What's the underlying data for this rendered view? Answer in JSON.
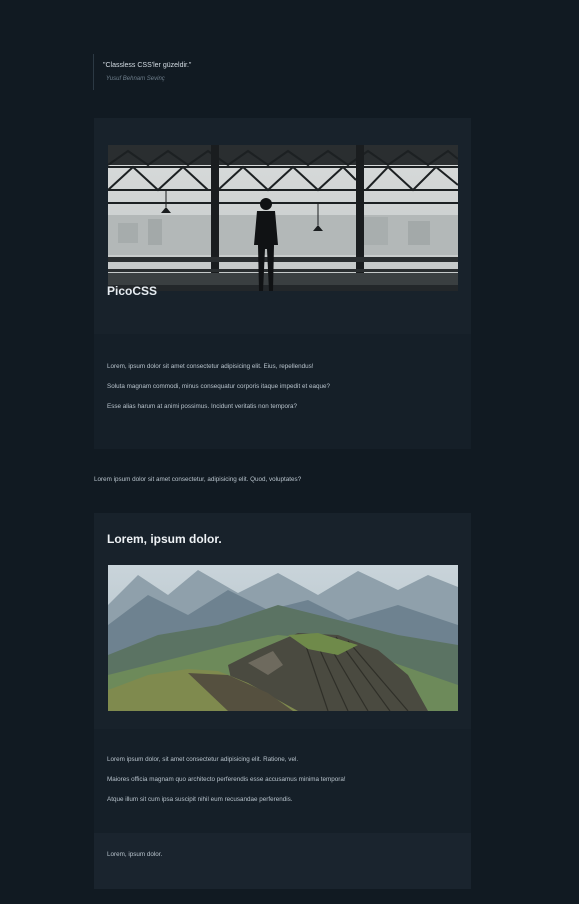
{
  "quote": {
    "text": "\"Classless CSS'ler güzeldir.\"",
    "cite": "Yusuf Behnam Sevinç"
  },
  "card1": {
    "image_caption": "PicoCSS",
    "paragraphs": [
      "Lorem, ipsum dolor sit amet consectetur adipisicing elit. Eius, repellendus!",
      "Soluta magnam commodi, minus consequatur corporis itaque impedit et eaque?",
      "Esse alias harum at animi possimus. Incidunt veritatis non tempora?"
    ]
  },
  "between_text": "Lorem ipsum dolor sit amet consectetur, adipisicing elit. Quod, voluptates?",
  "card2": {
    "title": "Lorem, ipsum dolor.",
    "paragraphs": [
      "Lorem ipsum dolor, sit amet consectetur adipisicing elit. Ratione, vel.",
      "Maiores officia magnam quo architecto perferendis esse accusamus minima tempora!",
      "Atque illum sit cum ipsa suscipit nihil eum recusandae perferendis."
    ],
    "footer": "Lorem, ipsum dolor."
  }
}
